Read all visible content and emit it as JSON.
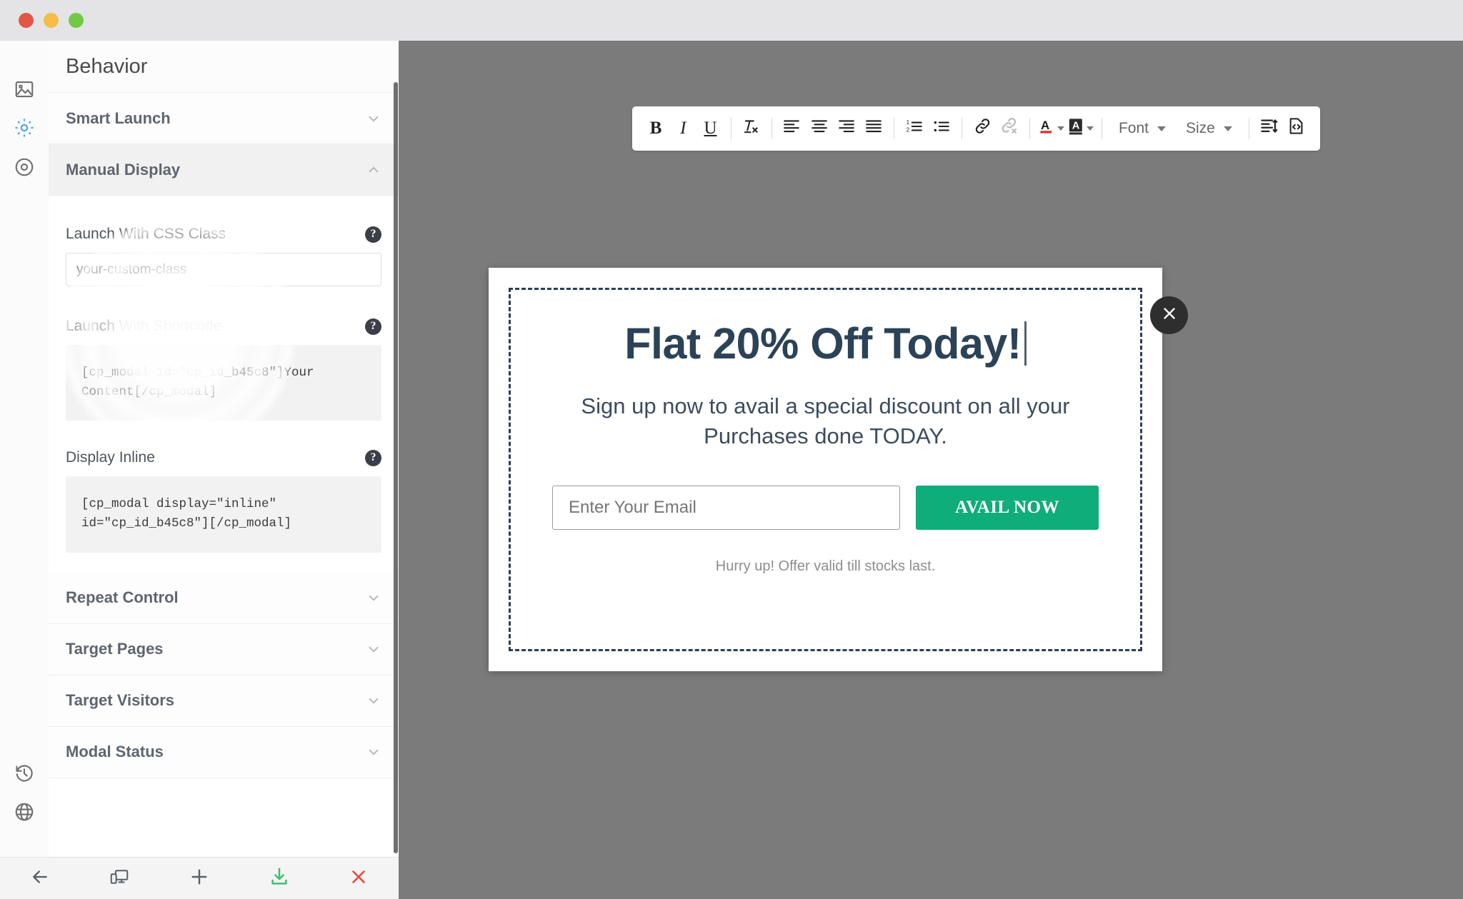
{
  "window": {
    "traffic_lights": [
      {
        "name": "close",
        "color": "#e05648"
      },
      {
        "name": "minimize",
        "color": "#f7bc4a"
      },
      {
        "name": "zoom",
        "color": "#72c946"
      }
    ]
  },
  "rail": {
    "items": [
      {
        "icon": "image-icon",
        "label": "Design",
        "active": false
      },
      {
        "icon": "gear-icon",
        "label": "Behavior",
        "active": true
      },
      {
        "icon": "target-icon",
        "label": "Triggers",
        "active": false
      }
    ],
    "bottom_items": [
      {
        "icon": "history-icon",
        "label": "History"
      },
      {
        "icon": "globe-icon",
        "label": "Site"
      }
    ]
  },
  "panel": {
    "title": "Behavior",
    "sections": [
      {
        "label": "Smart Launch",
        "open": false,
        "chevron": "chevron-down-icon"
      },
      {
        "label": "Manual Display",
        "open": true,
        "chevron": "chevron-up-icon"
      },
      {
        "label": "Repeat Control",
        "open": false,
        "chevron": "chevron-down-icon"
      },
      {
        "label": "Target Pages",
        "open": false,
        "chevron": "chevron-down-icon"
      },
      {
        "label": "Target Visitors",
        "open": false,
        "chevron": "chevron-down-icon"
      },
      {
        "label": "Modal Status",
        "open": false,
        "chevron": "chevron-down-icon"
      }
    ],
    "fields": {
      "css_class": {
        "label": "Launch With CSS Class",
        "help": "?",
        "value": "",
        "placeholder": "your-custom-class"
      },
      "shortcode": {
        "label": "Launch With Shortcode",
        "help": "?",
        "code": "[cp_modal id=\"cp_id_b45c8\"]Your Content[/cp_modal]"
      },
      "display_inline": {
        "label": "Display Inline",
        "help": "?",
        "code": "[cp_modal display=\"inline\" id=\"cp_id_b45c8\"][/cp_modal]"
      }
    }
  },
  "bottom_toolbar": {
    "buttons": [
      {
        "name": "back-button",
        "icon": "arrow-left-icon"
      },
      {
        "name": "responsive-preview-button",
        "icon": "devices-icon"
      },
      {
        "name": "add-button",
        "icon": "plus-icon"
      },
      {
        "name": "save-button",
        "icon": "download-icon",
        "color": "#3fbf6f"
      },
      {
        "name": "close-button",
        "icon": "x-icon",
        "color": "#e8493b"
      }
    ]
  },
  "editor_toolbar": {
    "buttons": [
      {
        "name": "bold-button",
        "icon": "bold-icon",
        "glyph": "B"
      },
      {
        "name": "italic-button",
        "icon": "italic-icon",
        "glyph": "I"
      },
      {
        "name": "underline-button",
        "icon": "underline-icon",
        "glyph": "U"
      },
      {
        "name": "remove-format-button",
        "icon": "remove-format-icon",
        "glyph": "Tx"
      },
      {
        "name": "align-left-button",
        "icon": "align-left-icon"
      },
      {
        "name": "align-center-button",
        "icon": "align-center-icon"
      },
      {
        "name": "align-right-button",
        "icon": "align-right-icon"
      },
      {
        "name": "align-justify-button",
        "icon": "align-justify-icon"
      },
      {
        "name": "ordered-list-button",
        "icon": "ordered-list-icon"
      },
      {
        "name": "unordered-list-button",
        "icon": "unordered-list-icon"
      },
      {
        "name": "link-button",
        "icon": "link-icon"
      },
      {
        "name": "unlink-button",
        "icon": "unlink-icon",
        "disabled": true
      },
      {
        "name": "text-color-button",
        "icon": "text-color-icon"
      },
      {
        "name": "highlight-color-button",
        "icon": "highlight-color-icon"
      },
      {
        "name": "line-height-button",
        "icon": "line-height-icon"
      },
      {
        "name": "source-code-button",
        "icon": "source-code-icon"
      }
    ],
    "font_dropdown": {
      "label": "Font",
      "caret": "chevron-down-icon"
    },
    "size_dropdown": {
      "label": "Size",
      "caret": "chevron-down-icon"
    }
  },
  "modal": {
    "heading": "Flat 20% Off Today!",
    "subheading": "Sign up now to avail a special discount on all your Purchases done TODAY.",
    "email_placeholder": "Enter Your Email",
    "email_value": "",
    "cta_label": "AVAIL NOW",
    "note": "Hurry up! Offer valid till stocks last.",
    "close_icon": "close-icon",
    "colors": {
      "heading": "#2b4257",
      "cta_background": "#0fad79",
      "dashed_border": "#2c3e52",
      "canvas": "#7b7b7b"
    }
  }
}
